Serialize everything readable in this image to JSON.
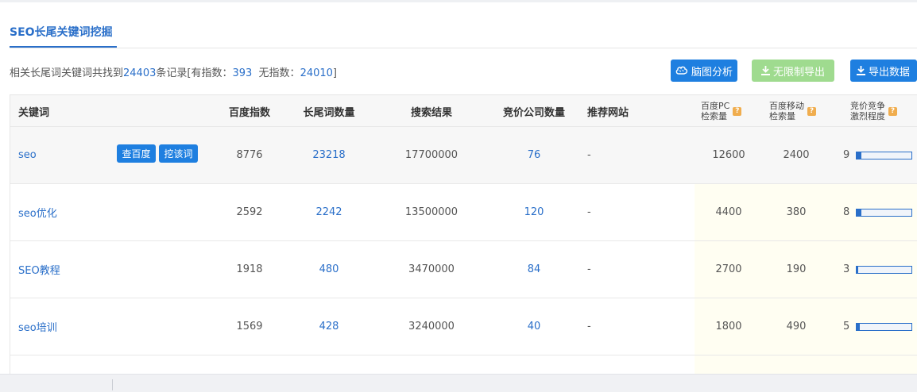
{
  "tab": {
    "label": "SEO长尾关键词挖掘"
  },
  "summary": {
    "prefix": "相关长尾词关键词共找到",
    "total": "24403",
    "mid": "条记录[有指数：",
    "with_index": "393",
    "mid2": "无指数：",
    "without_index": "24010",
    "suffix": "]"
  },
  "actions": {
    "mind_map": "脑图分析",
    "unlimited_export": "无限制导出",
    "export": "导出数据"
  },
  "table": {
    "headers": {
      "keyword": "关键词",
      "baidu_index": "百度指数",
      "longtail_count": "长尾词数量",
      "search_results": "搜索结果",
      "bidding_companies": "竞价公司数量",
      "recommended_site": "推荐网站",
      "pc_volume_l1": "百度PC",
      "pc_volume_l2": "检索量",
      "mobile_volume_l1": "百度移动",
      "mobile_volume_l2": "检索量",
      "competition_l1": "竞价竞争",
      "competition_l2": "激烈程度"
    },
    "row_buttons": {
      "check_baidu": "查百度",
      "dig_word": "挖该词"
    },
    "rows": [
      {
        "keyword": "seo",
        "baidu_index": "8776",
        "longtail_count": "23218",
        "search_results": "17700000",
        "bidding_companies": "76",
        "recommended_site": "-",
        "pc_volume": "12600",
        "mobile_volume": "2400",
        "competition": "9",
        "competition_level": 0.09
      },
      {
        "keyword": "seo优化",
        "baidu_index": "2592",
        "longtail_count": "2242",
        "search_results": "13500000",
        "bidding_companies": "120",
        "recommended_site": "-",
        "pc_volume": "4400",
        "mobile_volume": "380",
        "competition": "8",
        "competition_level": 0.08
      },
      {
        "keyword": "SEO教程",
        "baidu_index": "1918",
        "longtail_count": "480",
        "search_results": "3470000",
        "bidding_companies": "84",
        "recommended_site": "-",
        "pc_volume": "2700",
        "mobile_volume": "190",
        "competition": "3",
        "competition_level": 0.03
      },
      {
        "keyword": "seo培训",
        "baidu_index": "1569",
        "longtail_count": "428",
        "search_results": "3240000",
        "bidding_companies": "40",
        "recommended_site": "-",
        "pc_volume": "1800",
        "mobile_volume": "490",
        "competition": "5",
        "competition_level": 0.05
      }
    ]
  },
  "colors": {
    "accent": "#1e7fe0",
    "link": "#2a6fc9",
    "disabled_green": "#9fdb8f",
    "help_icon": "#f0ad4e"
  },
  "icons": {
    "mind_map": "brain-icon",
    "download": "download-icon",
    "help": "question-icon"
  }
}
